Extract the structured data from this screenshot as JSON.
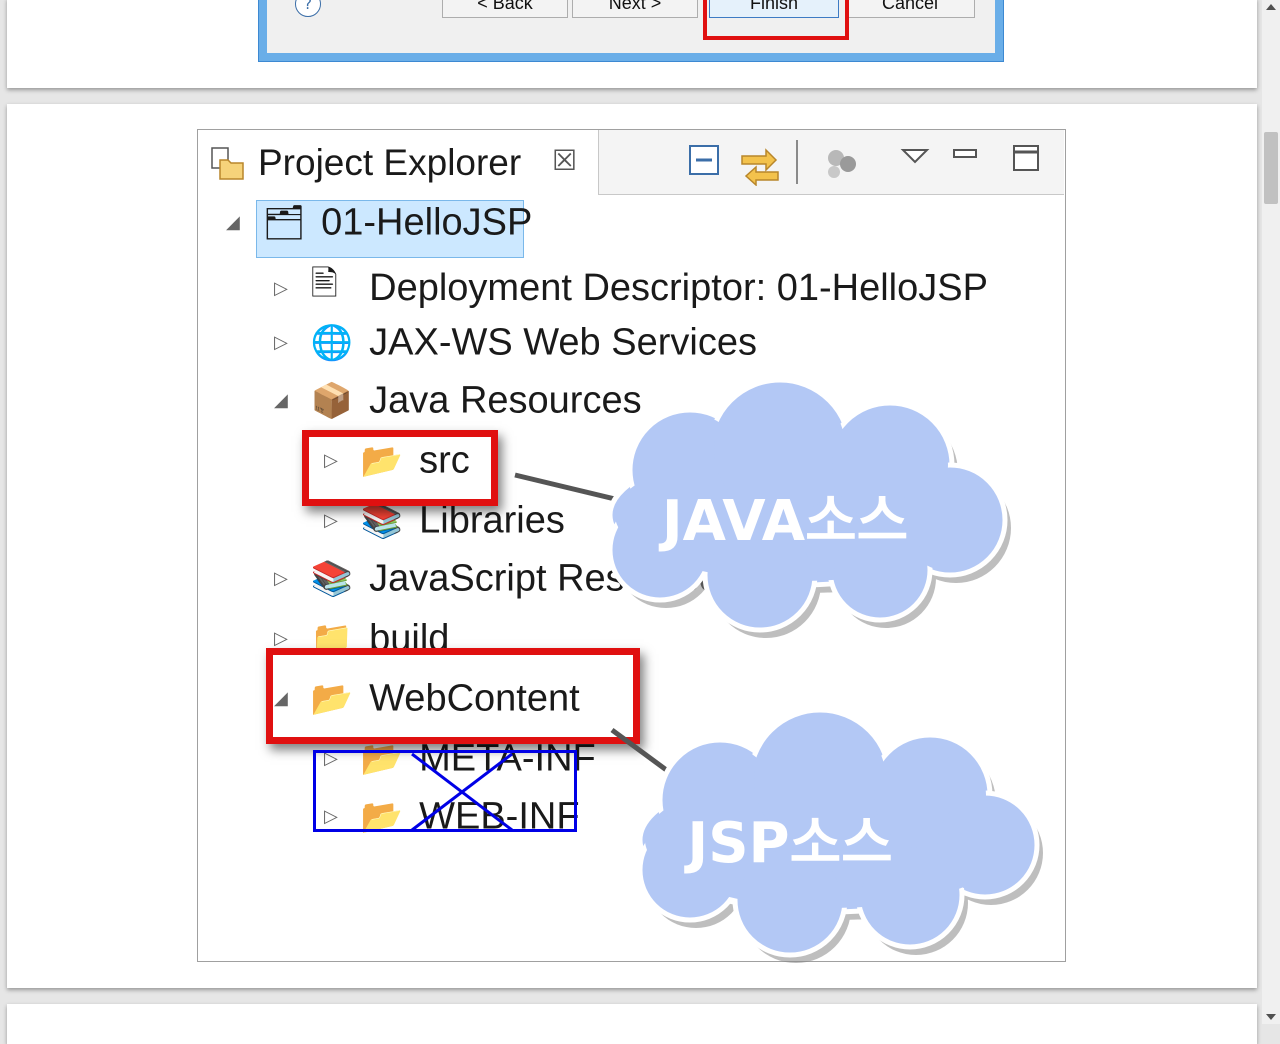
{
  "wizard": {
    "help_glyph": "?",
    "back_label": "< Back",
    "next_label": "Next >",
    "finish_label": "Finish",
    "cancel_label": "Cancel"
  },
  "explorer": {
    "title": "Project Explorer",
    "close_glyph": "☒",
    "toolbar_icons": [
      "collapse-all-icon",
      "link-with-editor-icon",
      "filter-icon",
      "view-menu-icon",
      "minimize-icon",
      "maximize-icon"
    ],
    "tree": [
      {
        "label": "01-HelloJSP",
        "icon": "web-project-icon",
        "expanded": true,
        "selected": true
      },
      {
        "label": "Deployment Descriptor: 01-HelloJSP",
        "icon": "deployment-descriptor-icon",
        "expanded": false
      },
      {
        "label": "JAX-WS Web Services",
        "icon": "web-services-icon",
        "expanded": false
      },
      {
        "label": "Java Resources",
        "icon": "java-resources-icon",
        "expanded": true
      },
      {
        "label": "src",
        "icon": "source-folder-icon",
        "expanded": false
      },
      {
        "label": "Libraries",
        "icon": "libraries-icon",
        "expanded": false
      },
      {
        "label": "JavaScript Resources",
        "icon": "libraries-icon",
        "expanded": false
      },
      {
        "label": "build",
        "icon": "folder-icon",
        "expanded": false
      },
      {
        "label": "WebContent",
        "icon": "folder-icon",
        "expanded": true
      },
      {
        "label": "META-INF",
        "icon": "folder-icon",
        "expanded": false
      },
      {
        "label": "WEB-INF",
        "icon": "folder-icon",
        "expanded": false
      }
    ]
  },
  "annotations": {
    "java_cloud": "JAVA소스",
    "jsp_cloud": "JSP소스"
  },
  "colors": {
    "highlight_red": "#e01010",
    "cross_blue": "#0000e6",
    "cloud_fill": "#b3c8f5",
    "selection": "#cce8ff"
  }
}
